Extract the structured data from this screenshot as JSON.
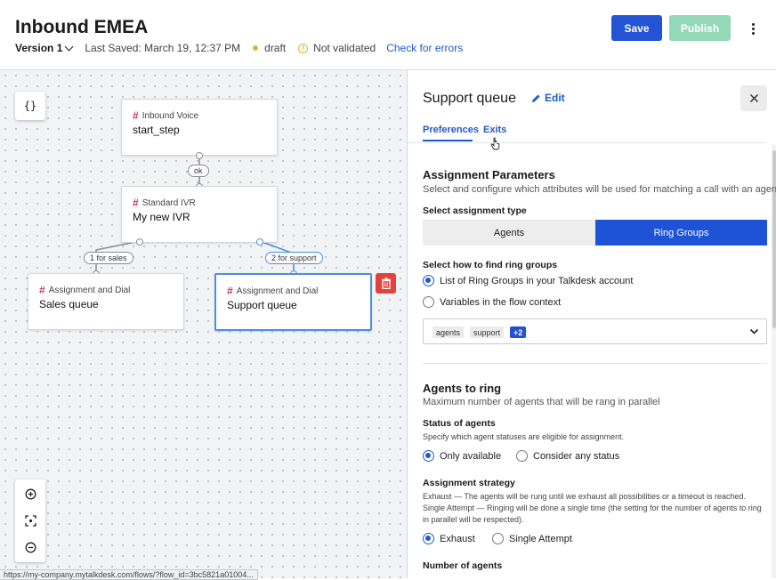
{
  "header": {
    "title": "Inbound EMEA",
    "version_label": "Version 1",
    "last_saved": "Last Saved: March 19, 12:37 PM",
    "status_draft": "draft",
    "status_validation": "Not validated",
    "check_errors_link": "Check for errors",
    "save_label": "Save",
    "publish_label": "Publish",
    "colors": {
      "save": "#2453d6",
      "publish_disabled": "#93d9b9",
      "draft_dot": "#e0b43a"
    }
  },
  "canvas": {
    "variables_button": "{}",
    "nodes": [
      {
        "type": "Inbound Voice",
        "name": "start_step"
      },
      {
        "type": "Standard IVR",
        "name": "My new IVR"
      },
      {
        "type": "Assignment and Dial",
        "name": "Sales queue"
      },
      {
        "type": "Assignment and Dial",
        "name": "Support queue",
        "selected": true
      }
    ],
    "edge_labels": [
      "ok",
      "1 for sales",
      "2 for support"
    ],
    "zoom_controls": [
      "zoom-in-icon",
      "fit-view-icon",
      "zoom-out-icon"
    ],
    "status_url": "https://my-company.mytalkdesk.com/flows/?flow_id=3bc5821a01004..."
  },
  "panel": {
    "title": "Support queue",
    "edit_label": "Edit",
    "tabs": [
      {
        "label": "Preferences",
        "active": true
      },
      {
        "label": "Exits",
        "active": false
      }
    ],
    "assignment": {
      "title": "Assignment Parameters",
      "description": "Select and configure which attributes will be used for matching a call with an agent",
      "type_label": "Select assignment type",
      "type_options": [
        "Agents",
        "Ring Groups"
      ],
      "selected_type": "Ring Groups",
      "find_label": "Select how to find ring groups",
      "find_options": [
        "List of Ring Groups in your Talkdesk account",
        "Variables in the flow context"
      ],
      "selected_find": "List of Ring Groups in your Talkdesk account",
      "selected_groups": [
        "agents",
        "support"
      ],
      "more_count": "+2"
    },
    "agents_to_ring": {
      "title": "Agents to ring",
      "description": "Maximum number of agents that will be rang in parallel",
      "status_label": "Status of agents",
      "status_desc": "Specify which agent statuses are eligible for assignment.",
      "status_options": [
        "Only available",
        "Consider any status"
      ],
      "selected_status": "Only available",
      "strategy_label": "Assignment strategy",
      "strategy_desc_1": "Exhaust — The agents will be rung until we exhaust all possibilities or a timeout is reached.",
      "strategy_desc_2": "Single Attempt — Ringing will be done a single time (the setting for the number of agents to ring in parallel will be respected).",
      "strategy_options": [
        "Exhaust",
        "Single Attempt"
      ],
      "selected_strategy": "Exhaust",
      "number_label": "Number of agents"
    }
  }
}
